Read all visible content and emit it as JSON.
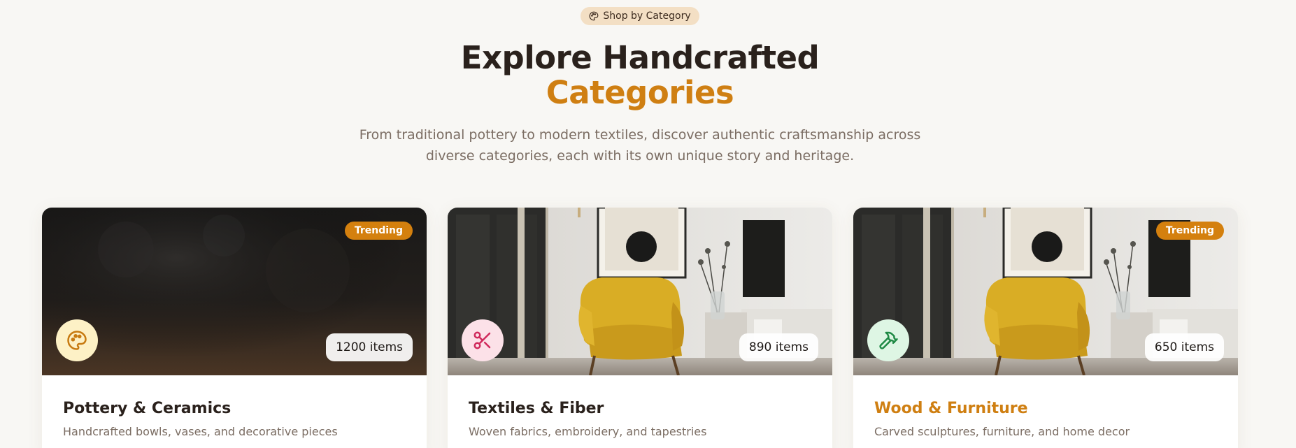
{
  "header": {
    "pill_label": "Shop by Category",
    "title_line1": "Explore Handcrafted",
    "title_line2": "Categories",
    "subtitle": "From traditional pottery to modern textiles, discover authentic craftsmanship across diverse categories, each with its own unique story and heritage."
  },
  "colors": {
    "accent": "#cf7f12",
    "trending_badge": "#d4800e",
    "background": "#f8f7f4",
    "pottery_icon_bg": "#fdf1c6",
    "textiles_icon_bg": "#fce1e8",
    "wood_icon_bg": "#def6e4"
  },
  "cards": [
    {
      "badge": "Trending",
      "icon": "palette-icon",
      "count": "1200 items",
      "title": "Pottery & Ceramics",
      "description": "Handcrafted bowls, vases, and decorative pieces"
    },
    {
      "badge": "",
      "icon": "scissors-icon",
      "count": "890 items",
      "title": "Textiles & Fiber",
      "description": "Woven fabrics, embroidery, and tapestries"
    },
    {
      "badge": "Trending",
      "icon": "hammer-icon",
      "count": "650 items",
      "title": "Wood & Furniture",
      "description": "Carved sculptures, furniture, and home decor"
    }
  ]
}
